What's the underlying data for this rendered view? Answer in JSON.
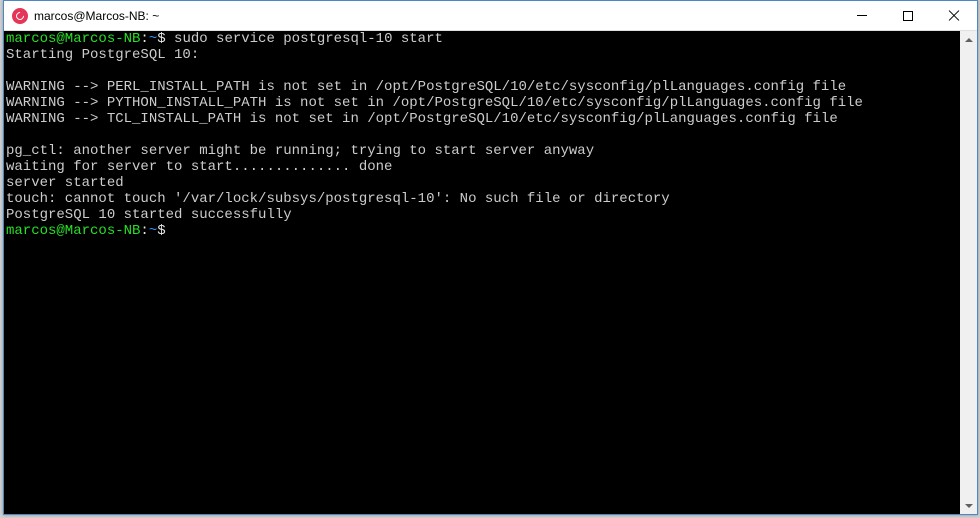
{
  "window": {
    "title": "marcos@Marcos-NB: ~"
  },
  "terminal": {
    "prompt1_user": "marcos@Marcos-NB",
    "prompt1_colon": ":",
    "prompt1_path": "~",
    "prompt1_dollar": "$",
    "command1": " sudo service postgresql-10 start",
    "line_starting": "Starting PostgreSQL 10:",
    "line_blank1": "",
    "line_warn1": "WARNING --> PERL_INSTALL_PATH is not set in /opt/PostgreSQL/10/etc/sysconfig/plLanguages.config file",
    "line_warn2": "WARNING --> PYTHON_INSTALL_PATH is not set in /opt/PostgreSQL/10/etc/sysconfig/plLanguages.config file",
    "line_warn3": "WARNING --> TCL_INSTALL_PATH is not set in /opt/PostgreSQL/10/etc/sysconfig/plLanguages.config file",
    "line_blank2": "",
    "line_pgctl": "pg_ctl: another server might be running; trying to start server anyway",
    "line_waiting": "waiting for server to start.............. done",
    "line_started": "server started",
    "line_touch": "touch: cannot touch '/var/lock/subsys/postgresql-10': No such file or directory",
    "line_success": "PostgreSQL 10 started successfully",
    "prompt2_user": "marcos@Marcos-NB",
    "prompt2_colon": ":",
    "prompt2_path": "~",
    "prompt2_dollar": "$"
  }
}
